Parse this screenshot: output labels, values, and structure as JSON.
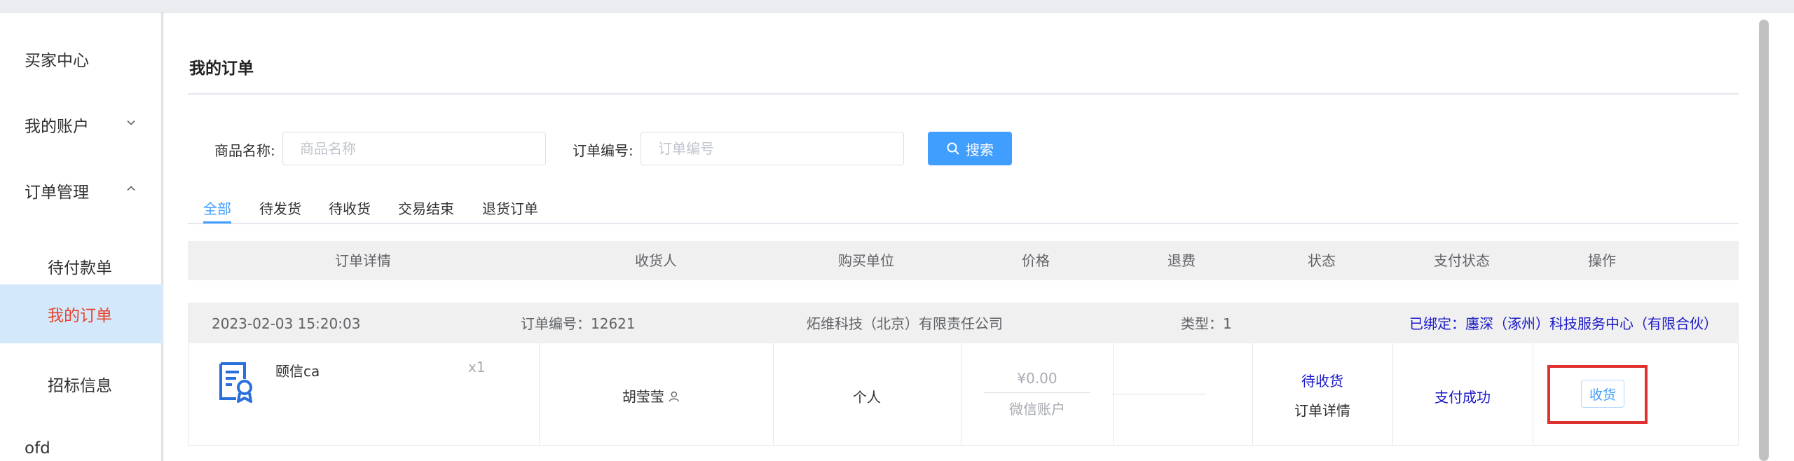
{
  "sidebar": {
    "items": [
      {
        "label": "买家中心"
      },
      {
        "label": "我的账户"
      },
      {
        "label": "订单管理"
      },
      {
        "label": "待付款单"
      },
      {
        "label": "我的订单"
      },
      {
        "label": "招标信息"
      },
      {
        "label": "ofd"
      }
    ]
  },
  "page": {
    "title": "我的订单"
  },
  "filters": {
    "product_name_label": "商品名称:",
    "product_name_placeholder": "商品名称",
    "product_name_value": "",
    "order_no_label": "订单编号:",
    "order_no_placeholder": "订单编号",
    "order_no_value": "",
    "search_label": "搜索"
  },
  "tabs": [
    {
      "label": "全部",
      "active": true
    },
    {
      "label": "待发货"
    },
    {
      "label": "待收货"
    },
    {
      "label": "交易结束"
    },
    {
      "label": "退货订单"
    }
  ],
  "table": {
    "columns": [
      "订单详情",
      "收货人",
      "购买单位",
      "价格",
      "退费",
      "状态",
      "支付状态",
      "操作"
    ]
  },
  "order": {
    "datetime": "2023-02-03 15:20:03",
    "order_no": "订单编号：12621",
    "company": "炻维科技（北京）有限责任公司",
    "type": "类型：1",
    "bound": "已绑定：廛深（涿州）科技服务中心（有限合伙）",
    "product_name": "颐信ca",
    "quantity": "x1",
    "consignee": "胡莹莹",
    "buyer_unit": "个人",
    "price": "¥0.00",
    "pay_method": "微信账户",
    "refund": "",
    "status": "待收货",
    "detail_link": "订单详情",
    "payment_status": "支付成功",
    "action_label": "收货"
  },
  "colors": {
    "accent": "#409eff",
    "active_menu_bg": "#d4e8fb",
    "active_menu_text": "#e6452d",
    "link_blue": "#1a1ac8",
    "highlight_red": "#e03131"
  },
  "icons": [
    "chevron-down-icon",
    "chevron-up-icon",
    "search-icon",
    "certificate-icon",
    "user-icon"
  ]
}
